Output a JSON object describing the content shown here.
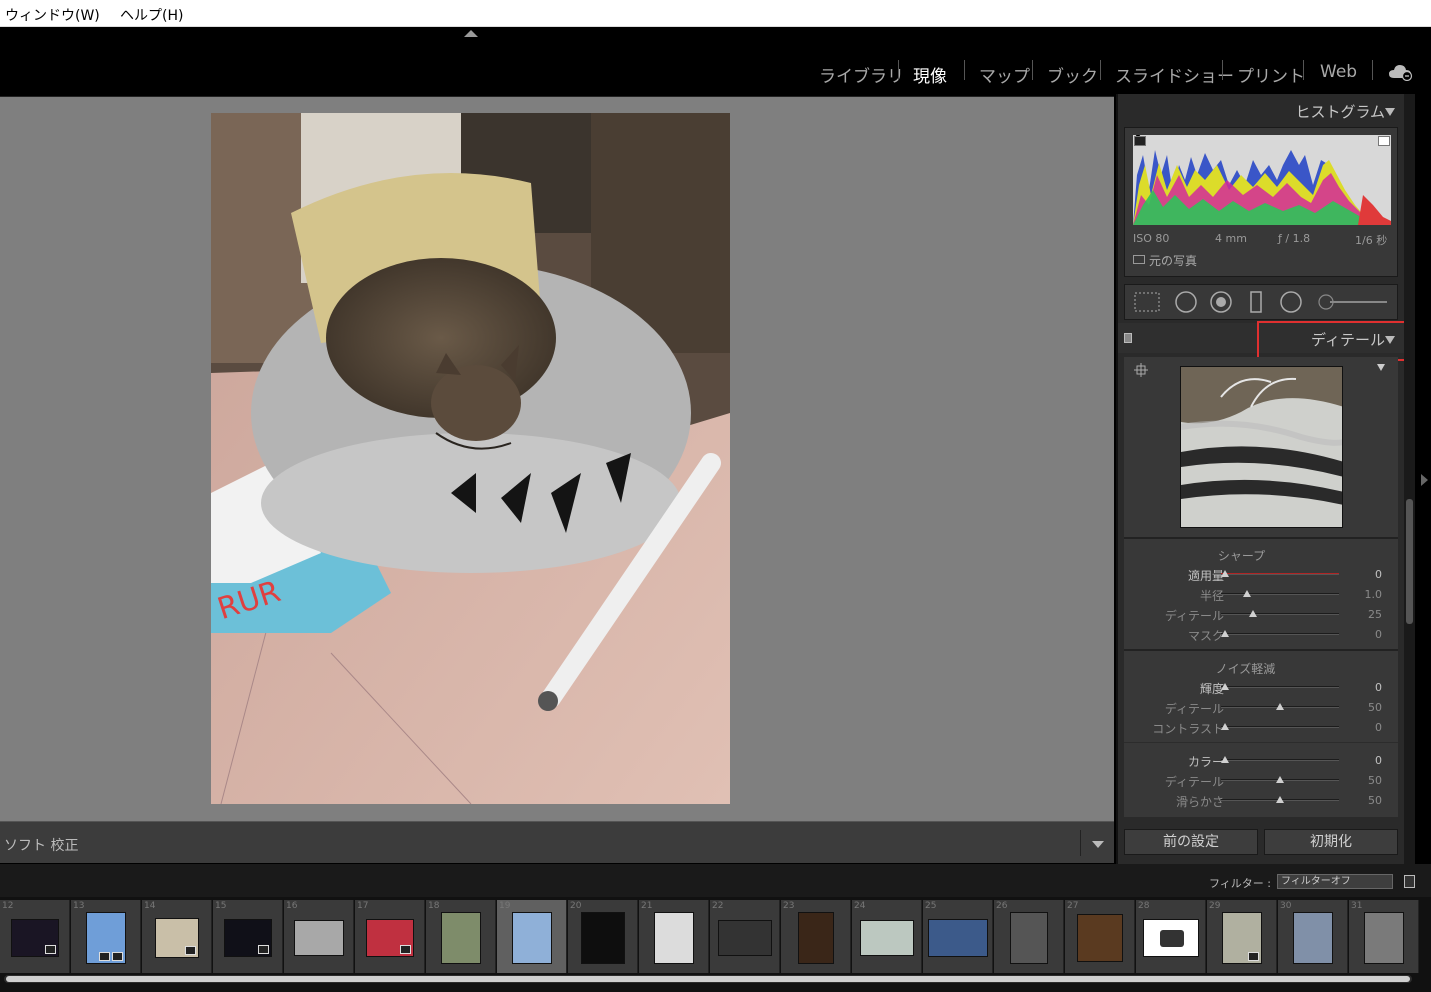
{
  "menu": {
    "window": "ウィンドウ(W)",
    "help": "ヘルプ(H)"
  },
  "modules": [
    {
      "label": "ライブラリ",
      "active": false
    },
    {
      "label": "現像",
      "active": true
    },
    {
      "label": "マップ",
      "active": false
    },
    {
      "label": "ブック",
      "active": false
    },
    {
      "label": "スライドショー",
      "active": false
    },
    {
      "label": "プリント",
      "active": false
    },
    {
      "label": "Web",
      "active": false
    }
  ],
  "toolbar": {
    "label": "ソフト 校正"
  },
  "histogram": {
    "title": "ヒストグラム",
    "iso": "ISO 80",
    "focal": "4 mm",
    "aperture": "ƒ / 1.8",
    "shutter": "1/6 秒",
    "original_photo": "元の写真"
  },
  "detail": {
    "title": "ディテール",
    "sharpen": {
      "title": "シャープ",
      "amount_label": "適用量",
      "amount_value": "0",
      "radius_label": "半径",
      "radius_value": "1.0",
      "detail_label": "ディテール",
      "detail_value": "25",
      "mask_label": "マスク",
      "mask_value": "0"
    },
    "noise": {
      "title": "ノイズ軽減",
      "luminance_label": "輝度",
      "luminance_value": "0",
      "lum_detail_label": "ディテール",
      "lum_detail_value": "50",
      "contrast_label": "コントラスト",
      "contrast_value": "0",
      "color_label": "カラー",
      "color_value": "0",
      "color_detail_label": "ディテール",
      "color_detail_value": "50",
      "smoothness_label": "滑らかさ",
      "smoothness_value": "50"
    },
    "slider_levels": {
      "amount": 0.0,
      "radius": 0.2,
      "detail": 0.25,
      "mask": 0.0,
      "luminance": 0.0,
      "lum_detail": 0.5,
      "contrast": 0.0,
      "color": 0.0,
      "color_detail": 0.5,
      "smoothness": 0.5
    }
  },
  "buttons": {
    "previous": "前の設定",
    "reset": "初期化"
  },
  "filmstrip": {
    "filter_label": "フィルター :",
    "filter_value": "フィルターオフ",
    "numbers": [
      "12",
      "13",
      "14",
      "15",
      "16",
      "17",
      "18",
      "19",
      "20",
      "21",
      "22",
      "23",
      "24",
      "25",
      "26",
      "27",
      "28",
      "29",
      "30",
      "31"
    ],
    "selected": "19"
  },
  "colors": {
    "highlight_box": "#e03030",
    "active_module": "#ffffff",
    "inactive_module": "#a8a8a8"
  }
}
